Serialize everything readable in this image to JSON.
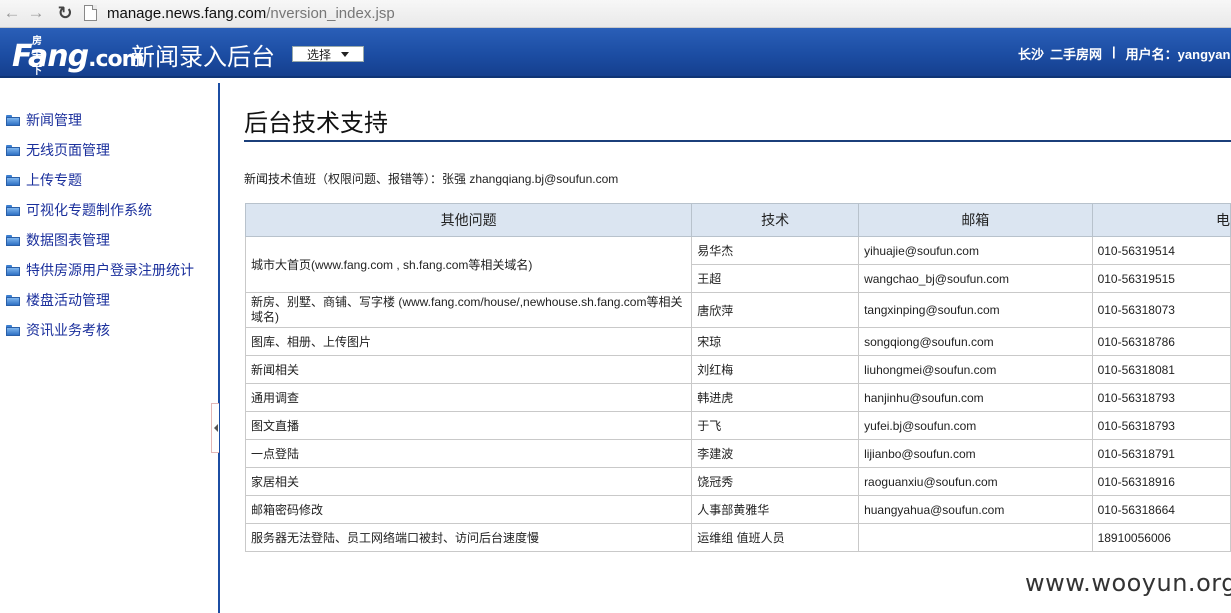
{
  "browser": {
    "url_host": "manage.news.fang.com",
    "url_path": "/nversion_index.jsp",
    "icons": [
      "back-arrow-icon",
      "forward-arrow-icon",
      "reload-icon",
      "page-icon"
    ]
  },
  "header": {
    "logo_small": "房天下",
    "logo_main": "Fang",
    "logo_suffix": ".com",
    "title": "新闻录入后台",
    "select_label": "选择",
    "city": "长沙",
    "channel": "二手房网",
    "separator": "|",
    "user_label": "用户名：yangyan"
  },
  "sidebar": {
    "items": [
      {
        "label": "新闻管理"
      },
      {
        "label": "无线页面管理"
      },
      {
        "label": "上传专题"
      },
      {
        "label": "可视化专题制作系统"
      },
      {
        "label": "数据图表管理"
      },
      {
        "label": "特供房源用户登录注册统计"
      },
      {
        "label": "楼盘活动管理"
      },
      {
        "label": "资讯业务考核"
      }
    ]
  },
  "main": {
    "title": "后台技术支持",
    "duty_line": "新闻技术值班（权限问题、报错等）：张强 zhangqiang.bj@soufun.com",
    "table": {
      "headers": [
        "其他问题",
        "技术",
        "邮箱",
        "电"
      ],
      "rows": [
        {
          "issue": "城市大首页(www.fang.com , sh.fang.com等相关域名)",
          "tech": "易华杰",
          "email": "yihuajie@soufun.com",
          "phone": "010-56319514"
        },
        {
          "issue": "",
          "tech": "王超",
          "email": "wangchao_bj@soufun.com",
          "phone": "010-56319515"
        },
        {
          "issue": "新房、别墅、商铺、写字楼 (www.fang.com/house/,newhouse.sh.fang.com等相关域名)",
          "tech": "唐欣萍",
          "email": "tangxinping@soufun.com",
          "phone": "010-56318073"
        },
        {
          "issue": "图库、相册、上传图片",
          "tech": "宋琼",
          "email": "songqiong@soufun.com",
          "phone": "010-56318786"
        },
        {
          "issue": "新闻相关",
          "tech": "刘红梅",
          "email": "liuhongmei@soufun.com",
          "phone": "010-56318081"
        },
        {
          "issue": "通用调查",
          "tech": "韩进虎",
          "email": "hanjinhu@soufun.com",
          "phone": "010-56318793"
        },
        {
          "issue": "图文直播",
          "tech": "于飞",
          "email": "yufei.bj@soufun.com",
          "phone": "010-56318793"
        },
        {
          "issue": "一点登陆",
          "tech": "李建波",
          "email": "lijianbo@soufun.com",
          "phone": "010-56318791"
        },
        {
          "issue": "家居相关",
          "tech": "饶冠秀",
          "email": "raoguanxiu@soufun.com",
          "phone": "010-56318916"
        },
        {
          "issue": "邮箱密码修改",
          "tech": "人事部黄雅华",
          "email": "huangyahua@soufun.com",
          "phone": "010-56318664"
        },
        {
          "issue": "服务器无法登陆、员工网络端口被封、访问后台速度慢",
          "tech": "运维组 值班人员",
          "email": "",
          "phone": "18910056006"
        }
      ]
    }
  },
  "watermark": "www.wooyun.org",
  "colors": {
    "header_blue": "#1c4da3",
    "sidebar_link": "#1a2f9c",
    "table_header_bg": "#dbe5f1"
  }
}
